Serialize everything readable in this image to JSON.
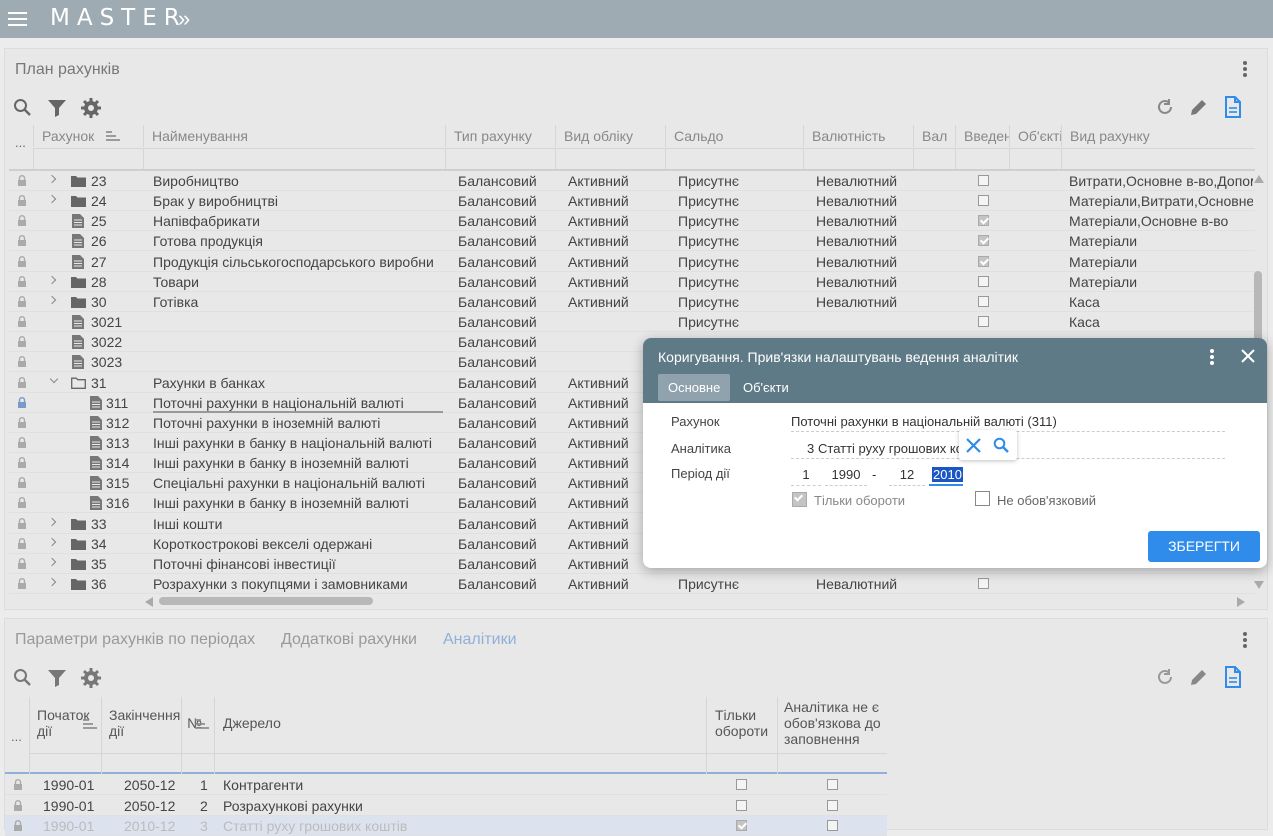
{
  "app": {
    "brand": "MASTER",
    "brand_chevron": "»"
  },
  "top_panel": {
    "title": "План рахунків",
    "columns": [
      "Рахунок",
      "Найменування",
      "Тип рахунку",
      "Вид обліку",
      "Сальдо",
      "Валютність",
      "Вал",
      "Введен",
      "Об'єкті",
      "Вид рахунку"
    ],
    "row_marker": "...",
    "rows": [
      {
        "code": "23",
        "name": "Виробництво",
        "type": "Балансовий",
        "acc": "Активний",
        "saldo": "Присутнє",
        "cur": "Невалютний",
        "chk": false,
        "kind": "Витрати,Основне в-во,Допом",
        "node": "folder",
        "expand": "r"
      },
      {
        "code": "24",
        "name": "Брак у виробництві",
        "type": "Балансовий",
        "acc": "Активний",
        "saldo": "Присутнє",
        "cur": "Невалютний",
        "chk": false,
        "kind": "Матеріали,Витрати,Основне",
        "node": "folder",
        "expand": "r"
      },
      {
        "code": "25",
        "name": "Напівфабрикати",
        "type": "Балансовий",
        "acc": "Активний",
        "saldo": "Присутнє",
        "cur": "Невалютний",
        "chk": true,
        "kind": "Матеріали,Основне в-во",
        "node": "doc",
        "expand": ""
      },
      {
        "code": "26",
        "name": "Готова продукція",
        "type": "Балансовий",
        "acc": "Активний",
        "saldo": "Присутнє",
        "cur": "Невалютний",
        "chk": true,
        "kind": "Матеріали",
        "node": "doc",
        "expand": ""
      },
      {
        "code": "27",
        "name": "Продукція сільськогосподарського виробни",
        "type": "Балансовий",
        "acc": "Активний",
        "saldo": "Присутнє",
        "cur": "Невалютний",
        "chk": true,
        "kind": "Матеріали",
        "node": "doc",
        "expand": ""
      },
      {
        "code": "28",
        "name": "Товари",
        "type": "Балансовий",
        "acc": "Активний",
        "saldo": "Присутнє",
        "cur": "Невалютний",
        "chk": false,
        "kind": "Матеріали",
        "node": "folder",
        "expand": "r"
      },
      {
        "code": "30",
        "name": "Готівка",
        "type": "Балансовий",
        "acc": "Активний",
        "saldo": "Присутнє",
        "cur": "Невалютний",
        "chk": false,
        "kind": "Каса",
        "node": "folder",
        "expand": "r"
      },
      {
        "code": "3021",
        "name": "",
        "type": "Балансовий",
        "acc": "",
        "saldo": "Присутнє",
        "cur": "",
        "chk": false,
        "kind": "Каса",
        "node": "doc",
        "expand": ""
      },
      {
        "code": "3022",
        "name": "",
        "type": "Балансовий",
        "acc": "",
        "saldo": "",
        "cur": "",
        "chk": null,
        "kind": "",
        "node": "doc",
        "expand": ""
      },
      {
        "code": "3023",
        "name": "",
        "type": "Балансовий",
        "acc": "",
        "saldo": "",
        "cur": "",
        "chk": null,
        "kind": "",
        "node": "doc",
        "expand": ""
      },
      {
        "code": "31",
        "name": "Рахунки в банках",
        "type": "Балансовий",
        "acc": "Активний",
        "saldo": "",
        "cur": "",
        "chk": null,
        "kind": "",
        "node": "folder-open",
        "expand": "d"
      },
      {
        "code": "311",
        "name": "Поточні рахунки в національній валюті",
        "type": "Балансовий",
        "acc": "Активний",
        "saldo": "",
        "cur": "",
        "chk": null,
        "kind": "",
        "node": "doc",
        "expand": "",
        "sub": true,
        "selected": true
      },
      {
        "code": "312",
        "name": "Поточні рахунки в іноземній валюті",
        "type": "Балансовий",
        "acc": "Активний",
        "saldo": "",
        "cur": "",
        "chk": null,
        "kind": "",
        "node": "doc",
        "expand": "",
        "sub": true
      },
      {
        "code": "313",
        "name": "Інші рахунки в банку в національній валюті",
        "type": "Балансовий",
        "acc": "Активний",
        "saldo": "",
        "cur": "",
        "chk": null,
        "kind": "",
        "node": "doc",
        "expand": "",
        "sub": true
      },
      {
        "code": "314",
        "name": "Інші рахунки в банку в іноземній валюті",
        "type": "Балансовий",
        "acc": "Активний",
        "saldo": "",
        "cur": "",
        "chk": null,
        "kind": "",
        "node": "doc",
        "expand": "",
        "sub": true
      },
      {
        "code": "315",
        "name": "Спеціальні рахунки в національній валюті",
        "type": "Балансовий",
        "acc": "Активний",
        "saldo": "",
        "cur": "",
        "chk": null,
        "kind": "",
        "node": "doc",
        "expand": "",
        "sub": true
      },
      {
        "code": "316",
        "name": "Інші рахунки в банку в іноземній валюті",
        "type": "Балансовий",
        "acc": "Активний",
        "saldo": "",
        "cur": "",
        "chk": null,
        "kind": "",
        "node": "doc",
        "expand": "",
        "sub": true
      },
      {
        "code": "33",
        "name": "Інші кошти",
        "type": "Балансовий",
        "acc": "Активний",
        "saldo": "",
        "cur": "",
        "chk": null,
        "kind": "",
        "node": "folder",
        "expand": "r"
      },
      {
        "code": "34",
        "name": "Короткострокові векселі одержані",
        "type": "Балансовий",
        "acc": "Активний",
        "saldo": "",
        "cur": "",
        "chk": null,
        "kind": "",
        "node": "folder",
        "expand": "r"
      },
      {
        "code": "35",
        "name": "Поточні фінансові інвестиції",
        "type": "Балансовий",
        "acc": "Активний",
        "saldo": "",
        "cur": "",
        "chk": null,
        "kind": "",
        "node": "folder",
        "expand": "r"
      },
      {
        "code": "36",
        "name": "Розрахунки з покупцями і замовниками",
        "type": "Балансовий",
        "acc": "Активний",
        "saldo": "Присутнє",
        "cur": "Невалютний",
        "chk": false,
        "kind": "",
        "node": "folder",
        "expand": "r"
      }
    ]
  },
  "bottom_panel": {
    "tabs": [
      "Параметри рахунків по періодах",
      "Додаткові рахунки",
      "Аналітики"
    ],
    "active_tab": 2,
    "columns": {
      "start": "Початок дії",
      "end": "Закінчення дії",
      "num": "№",
      "source": "Джерело",
      "only_turnover": "Тільки обороти",
      "optional": "Аналітика не є обов'язкова до заповнення"
    },
    "rows": [
      {
        "start": "1990-01",
        "end": "2050-12",
        "num": "1",
        "source": "Контрагенти",
        "turn": false,
        "opt": false
      },
      {
        "start": "1990-01",
        "end": "2050-12",
        "num": "2",
        "source": "Розрахункові рахунки",
        "turn": false,
        "opt": false
      },
      {
        "start": "1990-01",
        "end": "2010-12",
        "num": "3",
        "source": "Статті руху грошових коштів",
        "turn": true,
        "opt": false
      }
    ]
  },
  "dialog": {
    "title": "Коригування. Прив'язки налаштувань ведення аналітик",
    "tabs": [
      "Основне",
      "Об'єкти"
    ],
    "account_label": "Рахунок",
    "account_value": "Поточні рахунки в національній валюті (311)",
    "analytic_label": "Аналітика",
    "analytic_num": "3",
    "analytic_value": "Статті руху грошових ко",
    "period_label": "Період дії",
    "period_from_month": "1",
    "period_from_year": "1990",
    "period_dash": "-",
    "period_to_month": "12",
    "period_to_year": "2010",
    "only_turnover_label": "Тільки обороти",
    "only_turnover_checked": true,
    "optional_label": "Не обов'язковий",
    "optional_checked": false,
    "save_label": "ЗБЕРЕГТИ"
  }
}
